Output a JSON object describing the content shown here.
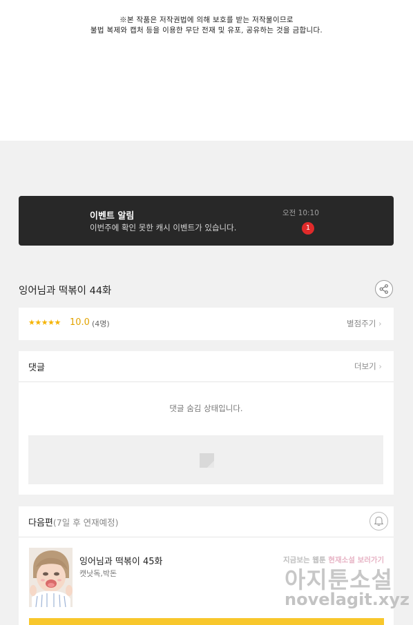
{
  "copyright": {
    "line1": "※본 작품은 저작권법에 의해 보호를 받는 저작물이므로",
    "line2": "불법 복제와 캡처 등을 이용한 무단 전재 및 유포, 공유하는 것을 금합니다."
  },
  "event": {
    "title": "이벤트 알림",
    "message": "이번주에 확인 못한 캐시 이벤트가 있습니다.",
    "time": "오전 10:10",
    "badge": "1"
  },
  "episode": {
    "title": "잉어님과 떡볶이 44화",
    "share_icon": "share-icon"
  },
  "rating": {
    "stars": "★★★★★",
    "score": "10.0",
    "count": "(4명)",
    "rate_label": "별점주기"
  },
  "comments": {
    "label": "댓글",
    "more_label": "더보기",
    "hidden_message": "댓글 숨김 상태입니다."
  },
  "next": {
    "label": "다음편",
    "schedule": "(7일 후 연재예정)",
    "title": "잉어님과 떡볶이 45화",
    "author": "캣낫독,박돈",
    "bell_icon": "bell-icon"
  },
  "watermark": {
    "line1_a": "지금보는 웹툰",
    "line1_b": "현재소설 보러가기",
    "line2": "아지툰소설",
    "line3": "novelagit.xyz"
  },
  "colors": {
    "event_bg": "#282828",
    "badge": "#e02a2a",
    "star": "#f5b301",
    "button": "#f8c72c"
  }
}
